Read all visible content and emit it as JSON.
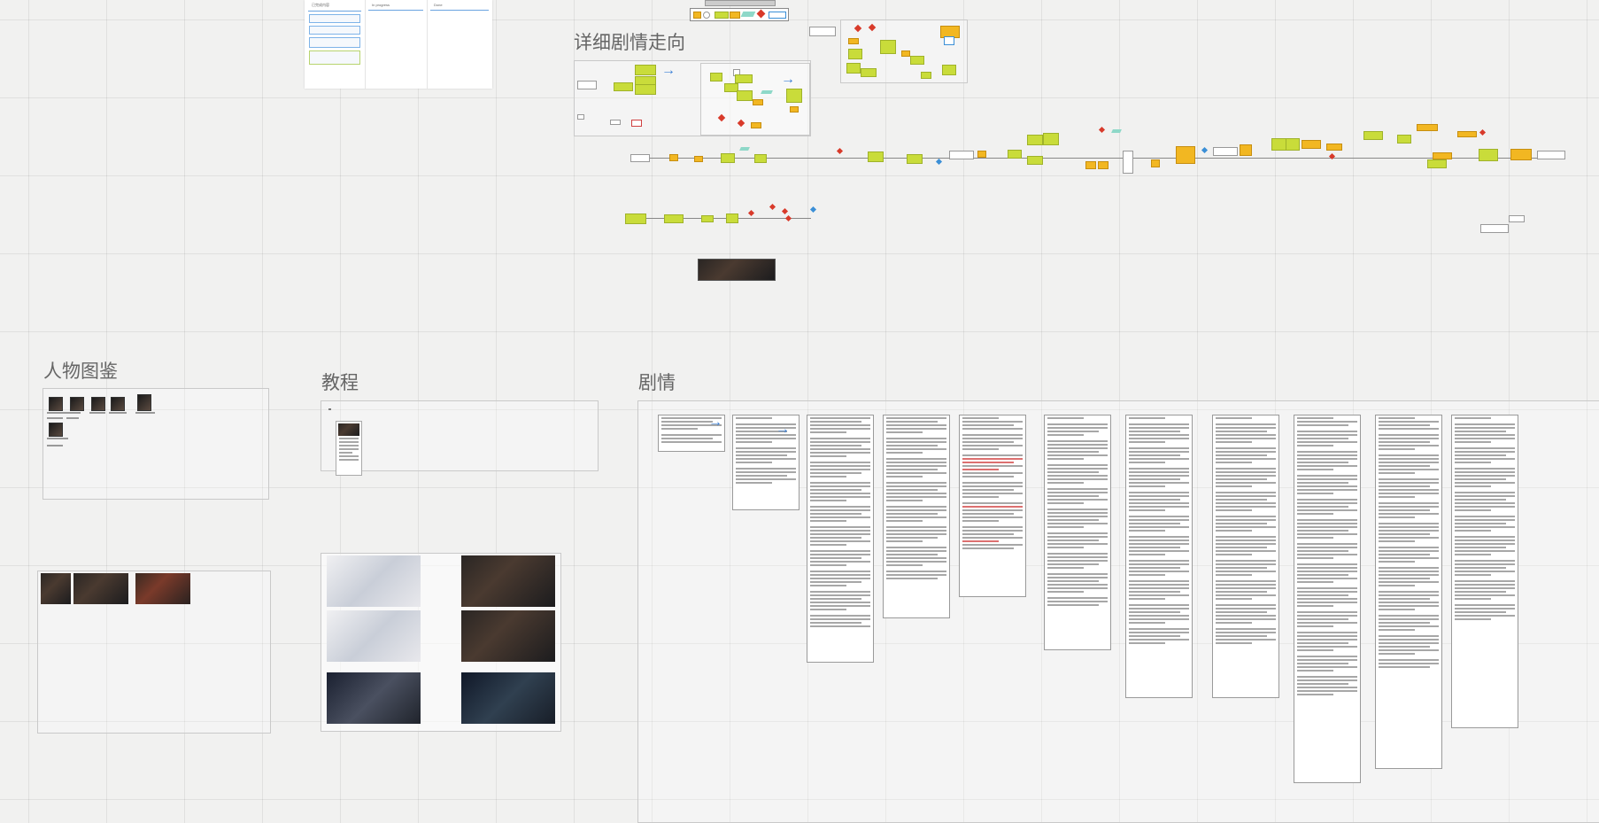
{
  "canvas": {
    "background": "#f1f1f0"
  },
  "sections": {
    "detailed_plot": "详细剧情走向",
    "characters": "人物图鉴",
    "tutorial": "教程",
    "plot": "剧情"
  },
  "kanban": {
    "columns": [
      "已完成内容",
      "In progress",
      "Done"
    ]
  },
  "tutorial_gallery": {
    "captions": [
      "",
      "",
      ""
    ]
  },
  "palette": {
    "shape_green": "#c9dc3a",
    "shape_yellow": "#f2b722",
    "decision_red": "#d83a2a",
    "decision_blue": "#3b8fd6",
    "connector_teal": "#8ed8c8",
    "arrow_blue": "#3b7fd6"
  },
  "icons": {
    "flow_arrow": "arrow-right-icon"
  }
}
